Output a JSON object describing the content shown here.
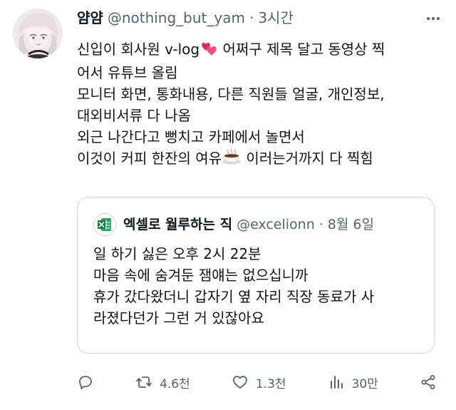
{
  "tweet": {
    "author_name": "얌얌",
    "handle": "@nothing_but_yam",
    "separator": "·",
    "time": "3시간",
    "lines": [
      "신입이 회사원 v-log",
      " 어쩌구 제목 달고 동영상 찍",
      "어서 유튜브 올림",
      "모니터 화면, 통화내용, 다른 직원들 얼굴, 개인정보,",
      "대외비서류 다 나옴",
      "외근 나간다고 뻥치고 카페에서 놀면서",
      "이것이 커피 한잔의 여유",
      " 이러는거까지 다 찍힘"
    ],
    "emojis": [
      "two-hearts-emoji",
      "hot-beverage-emoji"
    ]
  },
  "quoted": {
    "author_name": "엑셀로 월루하는 직",
    "handle": "@excelionn",
    "separator": "·",
    "time": "8월 6일",
    "avatar_icon": "excel-icon",
    "lines": [
      "일 하기 싫은 오후 2시 22분",
      "마음 속에 숨겨둔 잼얘는 없으십니까",
      "휴가 갔다왔더니 갑자기 옆 자리 직장 동료가 사",
      "라졌다던가 그런 거 있잖아요"
    ]
  },
  "actions": {
    "reply": {
      "icon": "reply-icon"
    },
    "retweet": {
      "icon": "retweet-icon",
      "count": "4.6천"
    },
    "like": {
      "icon": "heart-icon",
      "count": "1.3천"
    },
    "views": {
      "icon": "views-icon",
      "count": "30만"
    },
    "share": {
      "icon": "share-icon"
    }
  },
  "colors": {
    "text": "#0f1419",
    "secondary": "#536471",
    "border": "#cfd9de",
    "excel_green": "#107c41",
    "heart_pink": "#e0245e"
  }
}
